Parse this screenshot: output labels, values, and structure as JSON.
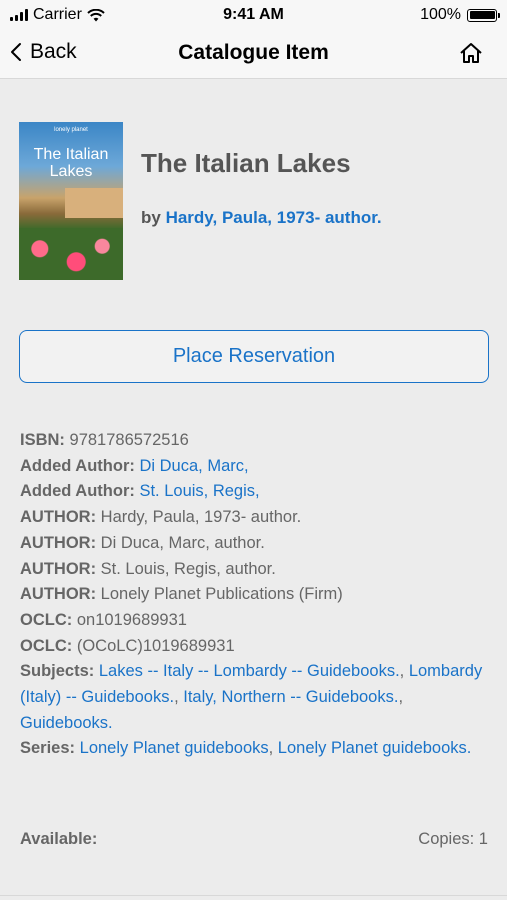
{
  "status_bar": {
    "carrier": "Carrier",
    "time": "9:41 AM",
    "battery": "100%"
  },
  "nav": {
    "back_label": "Back",
    "title": "Catalogue Item"
  },
  "book": {
    "cover_brand": "lonely planet",
    "cover_title": "The Italian Lakes",
    "title": "The Italian Lakes",
    "by_prefix": "by",
    "author": "Hardy, Paula, 1973- author."
  },
  "reserve_label": "Place Reservation",
  "details": {
    "isbn_label": "ISBN:",
    "isbn": "9781786572516",
    "added_author_label": "Added Author:",
    "added_authors": [
      "Di Duca, Marc,",
      "St. Louis, Regis,"
    ],
    "author_label": "AUTHOR:",
    "authors": [
      "Hardy, Paula, 1973- author.",
      "Di Duca, Marc, author.",
      "St. Louis, Regis, author.",
      "Lonely Planet Publications (Firm)"
    ],
    "oclc_label": "OCLC:",
    "oclcs": [
      "on1019689931",
      "(OCoLC)1019689931"
    ],
    "subjects_label": "Subjects:",
    "subjects": [
      "Lakes -- Italy -- Lombardy -- Guidebooks.",
      "Lombardy (Italy) -- Guidebooks.",
      "Italy, Northern -- Guidebooks.",
      "Guidebooks."
    ],
    "series_label": "Series:",
    "series": [
      "Lonely Planet guidebooks",
      "Lonely Planet guidebooks."
    ]
  },
  "availability": {
    "label": "Available:",
    "copies": "Copies: 1"
  },
  "colors": {
    "link": "#1a73c8",
    "text": "#666666",
    "background": "#ececec"
  }
}
